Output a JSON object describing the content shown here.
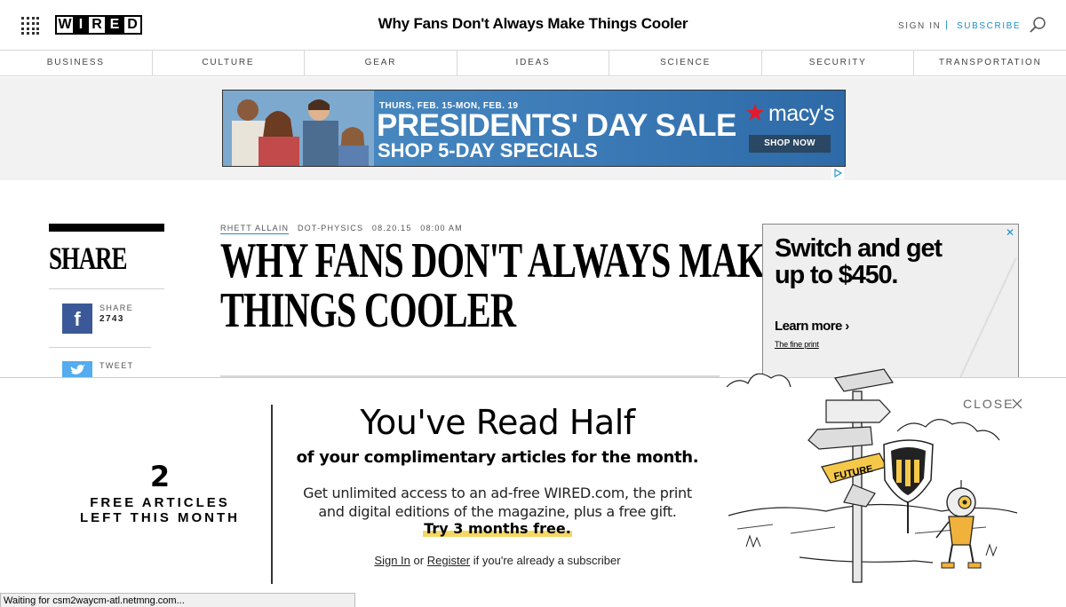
{
  "header": {
    "logo": [
      "W",
      "I",
      "R",
      "E",
      "D"
    ],
    "title": "Why Fans Don't Always Make Things Cooler",
    "sign_in": "SIGN IN",
    "separator": "|",
    "subscribe": "SUBSCRIBE"
  },
  "nav": [
    "BUSINESS",
    "CULTURE",
    "GEAR",
    "IDEAS",
    "SCIENCE",
    "SECURITY",
    "TRANSPORTATION"
  ],
  "banner_ad": {
    "dates": "THURS, FEB. 15-MON, FEB. 19",
    "headline": "PRESIDENTS' DAY SALE",
    "subline": "SHOP 5-DAY SPECIALS",
    "brand": "macy's",
    "button": "SHOP NOW"
  },
  "share": {
    "heading": "SHARE",
    "facebook_label": "SHARE",
    "facebook_count": "2743",
    "twitter_label": "TWEET"
  },
  "article": {
    "author": "RHETT ALLAIN",
    "section": "DOT-PHYSICS",
    "date": "08.20.15",
    "time": "08:00 AM",
    "headline_line1": "WHY FANS DON'T ALWAYS MAKE",
    "headline_line2": "THINGS COOLER"
  },
  "side_ad": {
    "close": "✕",
    "headline": "Switch and get up to $450.",
    "cta": "Learn more",
    "fine_print": "The fine print"
  },
  "paywall": {
    "count": "2",
    "count_label": "FREE ARTICLES LEFT THIS MONTH",
    "title": "You've Read Half",
    "subtitle": "of your complimentary articles for the month.",
    "body": "Get unlimited access to an ad-free WIRED.com, the print and digital editions of the magazine, plus a free gift.",
    "trial": "Try 3 months free.",
    "sign_in": "Sign In",
    "or": "or",
    "register": "Register",
    "suffix": "if you're already a subscriber",
    "close": "CLOSE",
    "sign_future": "FUTURE"
  },
  "status_bar": "Waiting for csm2waycm-atl.netmng.com..."
}
